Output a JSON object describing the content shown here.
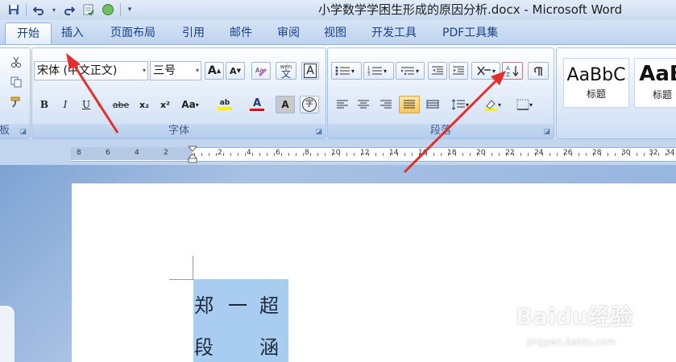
{
  "window": {
    "title": "小学数学学困生形成的原因分析.docx - Microsoft Word"
  },
  "quick_access": {
    "icons": [
      "save-icon",
      "undo-icon",
      "undo-dropdown-icon",
      "redo-icon",
      "spellcheck-icon",
      "circle-icon",
      "customize-dropdown-icon"
    ]
  },
  "tabs": [
    {
      "label": "开始",
      "active": true
    },
    {
      "label": "插入",
      "active": false
    },
    {
      "label": "页面布局",
      "active": false
    },
    {
      "label": "引用",
      "active": false
    },
    {
      "label": "邮件",
      "active": false
    },
    {
      "label": "审阅",
      "active": false
    },
    {
      "label": "视图",
      "active": false
    },
    {
      "label": "开发工具",
      "active": false
    },
    {
      "label": "PDF工具集",
      "active": false
    }
  ],
  "clipboard": {
    "label": "板"
  },
  "font_group": {
    "label": "字体",
    "font_name": "宋体 (中文正文)",
    "font_size": "三号",
    "buttons": {
      "grow": "A",
      "shrink": "A",
      "bold": "B",
      "italic": "I",
      "underline": "U",
      "strike": "abe",
      "subscript": "x₂",
      "superscript": "x²",
      "change_case": "Aa",
      "highlight": "ab",
      "font_color": "A",
      "char_shading": "A",
      "enclose": "字",
      "border": "A",
      "phonetic": "wén",
      "phonetic2": "文"
    }
  },
  "paragraph_group": {
    "label": "段落"
  },
  "styles_group": {
    "items": [
      {
        "sample": "AaBbC",
        "name": "标题"
      },
      {
        "sample": "AaB",
        "name": "标题"
      }
    ]
  },
  "ruler": {
    "left_ticks": [
      "8",
      "6",
      "4",
      "2"
    ],
    "right_ticks": [
      "2",
      "4",
      "6",
      "8",
      "10",
      "12",
      "14",
      "16",
      "18",
      "20",
      "22",
      "24",
      "26",
      "28",
      "30",
      "32",
      "34"
    ]
  },
  "document": {
    "row1": [
      "郑",
      "一",
      "超"
    ],
    "row2": [
      "段",
      "涵"
    ]
  },
  "watermark": {
    "brand": "Baidu经验",
    "url": "jingyan.baidu.com"
  },
  "colors": {
    "ribbon_blue": "#15428b",
    "arrow_red": "#e52d2d",
    "selection": "#a8cdf0"
  }
}
